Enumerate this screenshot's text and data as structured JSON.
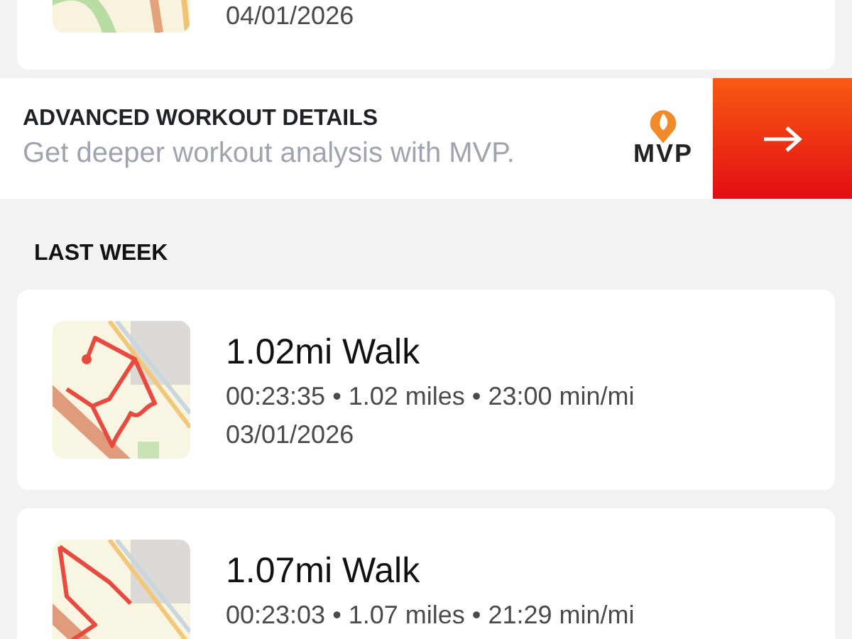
{
  "top_workout": {
    "date": "04/01/2026"
  },
  "promo": {
    "title": "ADVANCED WORKOUT DETAILS",
    "subtitle": "Get deeper workout analysis with MVP.",
    "logo_text": "MVP"
  },
  "section": {
    "heading": "LAST WEEK"
  },
  "workouts": [
    {
      "title": "1.02mi Walk",
      "stats": "00:23:35 • 1.02 miles • 23:00 min/mi",
      "date": "03/01/2026"
    },
    {
      "title": "1.07mi Walk",
      "stats": "00:23:03 • 1.07 miles • 21:29 min/mi"
    }
  ]
}
